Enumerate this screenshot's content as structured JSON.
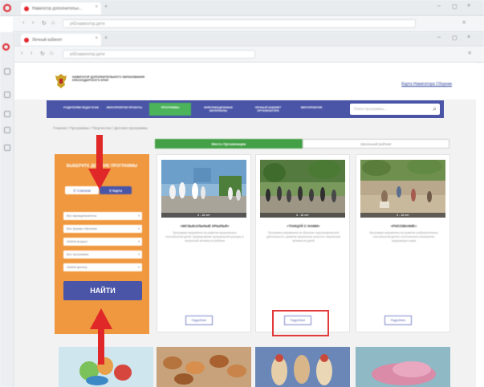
{
  "outer_browser": {
    "tab_title": "Навигатор дополнительн...",
    "url": "р42навигатор.дети"
  },
  "inner_browser": {
    "tab_title": "Личный кабинет",
    "url": "р42навигатор.дети"
  },
  "site": {
    "org_name": "Навигатор дополнительного образования Краснодарского края",
    "header_link": "Карта Навигатора Сборник",
    "menu": [
      {
        "label": "Родителям Педагогам"
      },
      {
        "label": "Мероприятия Проекты"
      },
      {
        "label": "Программы"
      },
      {
        "label": "Информационные материалы"
      },
      {
        "label": "Личный кабинет Организатора"
      },
      {
        "label": "Мероприятия"
      }
    ],
    "search_placeholder": "Поиск программы...",
    "breadcrumb": "Главная / Программы / Творчество / Детские программы",
    "tabs": {
      "active": "Места Организации",
      "inactive": "Школьный рейтинг"
    },
    "filter": {
      "title": "Выберите детские программы",
      "toggle_list": "Списком",
      "toggle_map": "Карта",
      "selects": [
        "Все муниципалитеты",
        "Все формы обучения",
        "Любой возраст",
        "Все программы",
        "Любой фильтр"
      ],
      "find_button": "НАЙТИ"
    },
    "cards": [
      {
        "age": "6 - 18 лет",
        "title": "«МУЗЫКАЛЬНЫЕ КРЫЛЬЯ»",
        "desc": "Программа направлена на развитие музыкальных способностей детей, формирование музыкальной культуры и творческой активности ребёнка",
        "more": "Подробнее"
      },
      {
        "age": "6 - 18 лет",
        "title": "«ТАНЦУЙ С НАМИ»",
        "desc": "Программа направлена на обучение хореографической деятельности, развитие физических качеств и творческой активности детей",
        "more": "Подробнее"
      },
      {
        "age": "5 - 18 лет",
        "title": "«РИСОВАНИЕ»",
        "desc": "Программа направлена на развитие изобразительных способностей детей и эстетического восприятия окружающего мира",
        "more": "Подробнее"
      }
    ]
  },
  "colors": {
    "menu_bg": "#4a55a7",
    "active_green": "#43a047",
    "filter_orange": "#f0983f",
    "arrow_red": "#e02828",
    "highlight_red": "#e23a3a"
  }
}
